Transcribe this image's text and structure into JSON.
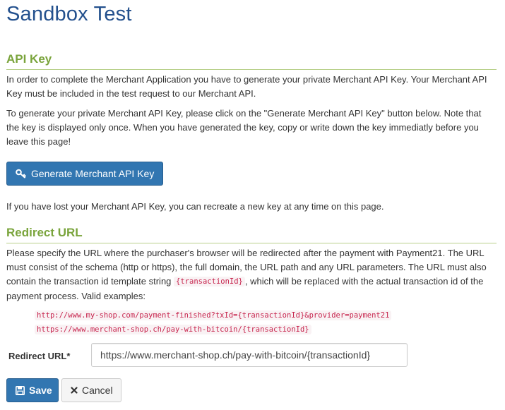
{
  "page": {
    "title": "Sandbox Test"
  },
  "api_key": {
    "title": "API Key",
    "para1": "In order to complete the Merchant Application you have to generate your private Merchant API Key. Your Merchant API Key must be included in the test request to our Merchant API.",
    "para2": "To generate your private Merchant API Key, please click on the \"Generate Merchant API Key\" button below. Note that the key is displayed only once. When you have generated the key, copy or write down the key immediatly before you leave this page!",
    "generate_button": "Generate Merchant API Key",
    "button_icon": "key-icon",
    "lost_note": "If you have lost your Merchant API Key, you can recreate a new key at any time on this page."
  },
  "redirect": {
    "title": "Redirect URL",
    "para_before": "Please specify the URL where the purchaser's browser will be redirected after the payment with Payment21. The URL must consist of the schema (http or https), the full domain, the URL path and any URL parameters. The URL must also contain the transaction id template string",
    "template_code": "{transactionId}",
    "para_after": ", which will be replaced with the actual transaction id of the payment process. Valid examples:",
    "examples": [
      "http://www.my-shop.com/payment-finished?txId={transactionId}&provider=payment21",
      "https://www.merchant-shop.ch/pay-with-bitcoin/{transactionId}"
    ],
    "field_label": "Redirect URL*",
    "field_value": "https://www.merchant-shop.ch/pay-with-bitcoin/{transactionId}"
  },
  "actions": {
    "save_label": "Save",
    "save_icon": "floppy-disk-icon",
    "cancel_label": "Cancel",
    "cancel_icon": "close-icon"
  },
  "colors": {
    "title": "#23508d",
    "section": "#7aa43c",
    "primary": "#3276b1",
    "code": "#c7254e"
  }
}
